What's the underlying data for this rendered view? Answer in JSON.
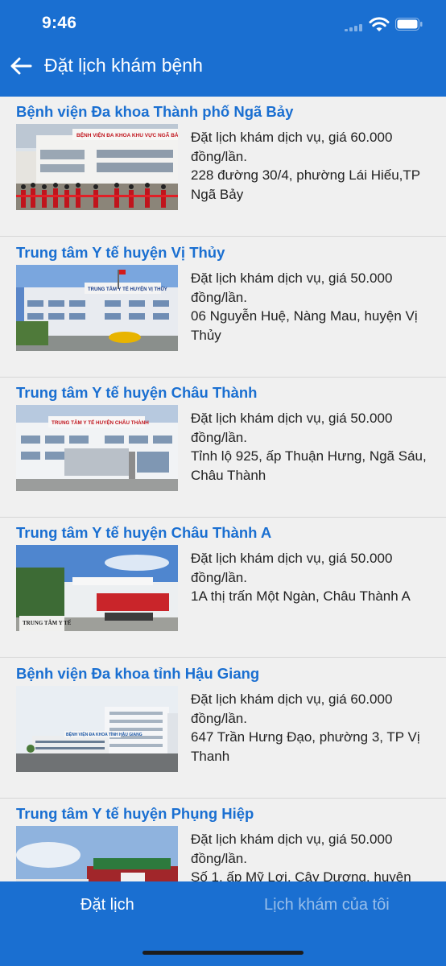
{
  "status_bar": {
    "time": "9:46"
  },
  "header": {
    "title": "Đặt lịch khám bệnh",
    "back_icon": "arrow-left-icon"
  },
  "hospitals": [
    {
      "name": "Bệnh viện Đa khoa Thành phố Ngã Bảy",
      "service": "Đặt lịch khám dịch vụ, giá 60.000 đồng/lần.",
      "address": "228 đường 30/4, phường Lái Hiếu,TP Ngã Bảy",
      "photo_sign": "BỆNH VIỆN ĐA KHOA KHU VỰC NGÃ BẢY"
    },
    {
      "name": "Trung tâm Y tế huyện Vị Thủy",
      "service": "Đặt lịch khám dịch vụ, giá 50.000 đồng/lần.",
      "address": "06 Nguyễn Huệ, Nàng Mau, huyện Vị Thủy",
      "photo_sign": "TRUNG TÂM Y TẾ HUYỆN VỊ THỦY"
    },
    {
      "name": "Trung tâm Y tế huyện Châu Thành",
      "service": "Đặt lịch khám dịch vụ, giá 50.000 đồng/lần.",
      "address": "Tỉnh lộ 925, ấp Thuận Hưng, Ngã Sáu, Châu Thành",
      "photo_sign": "TRUNG TÂM Y TẾ HUYỆN CHÂU THÀNH"
    },
    {
      "name": "Trung tâm Y tế huyện Châu Thành A",
      "service": "Đặt lịch khám dịch vụ, giá 50.000 đồng/lần.",
      "address": "1A thị trấn Một Ngàn, Châu Thành A",
      "photo_sign": "TRUNG TÂM Y TẾ"
    },
    {
      "name": "Bệnh viện Đa khoa tỉnh Hậu Giang",
      "service": "Đặt lịch khám dịch vụ, giá 60.000 đồng/lần.",
      "address": "647 Trần Hưng Đạo, phường 3, TP Vị Thanh",
      "photo_sign": "BỆNH VIỆN ĐA KHOA TỈNH HẬU GIANG"
    },
    {
      "name": "Trung tâm Y tế huyện Phụng Hiệp",
      "service": "Đặt lịch khám dịch vụ, giá 50.000 đồng/lần.",
      "address": "Số 1, ấp Mỹ Lợi, Cây Dương, huyện",
      "photo_sign": ""
    }
  ],
  "tabs": {
    "book": "Đặt lịch",
    "my_appointments": "Lịch khám của tôi"
  },
  "colors": {
    "primary": "#1a6fd1",
    "background": "#f0f0f0",
    "name_text": "#1a6fd1"
  }
}
